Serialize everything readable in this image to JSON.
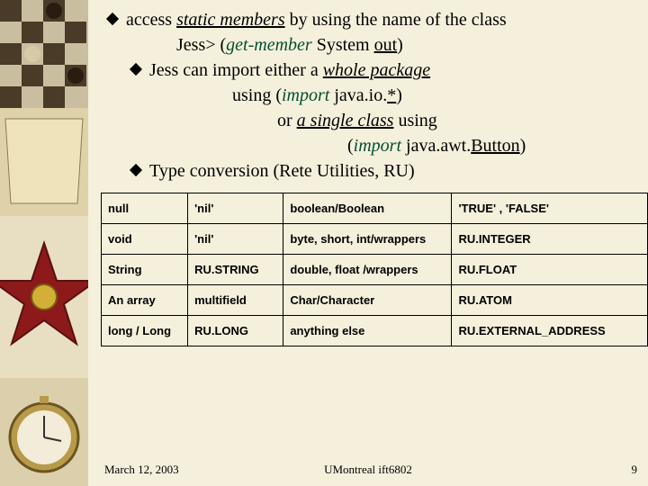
{
  "bullets": {
    "l1": "access ",
    "l1_ui": "static members",
    "l1b": " by using the name of the class",
    "l2_a": "Jess> (",
    "l2_i": "get-member",
    "l2_b": " System ",
    "l2_u": "out",
    "l2_c": ")",
    "l3": "Jess can import either a ",
    "l3_ui": "whole package",
    "l4_a": "using (",
    "l4_i": "import",
    "l4_b": " java.io.",
    "l4_u": "*",
    "l4_c": ")",
    "l5_a": "or ",
    "l5_ui": "a single class",
    "l5_b": " using",
    "l6_a": "(",
    "l6_i": "import",
    "l6_b": " java.awt.",
    "l6_u": "Button",
    "l6_c": ")",
    "l7": "Type conversion (Rete Utilities, RU)"
  },
  "table": {
    "r1c1": "null",
    "r1c2": "'nil'",
    "r1c3": "boolean/Boolean",
    "r1c4": "'TRUE' , 'FALSE'",
    "r2c1": "void",
    "r2c2": "'nil'",
    "r2c3": "byte, short, int/wrappers",
    "r2c4": "RU.INTEGER",
    "r3c1": "String",
    "r3c2": "RU.STRING",
    "r3c3": "double, float /wrappers",
    "r3c4": "RU.FLOAT",
    "r4c1": "An array",
    "r4c2": "multifield",
    "r4c3": "Char/Character",
    "r4c4": "RU.ATOM",
    "r5c1": "long / Long",
    "r5c2": "RU.LONG",
    "r5c3": "anything else",
    "r5c4": "RU.EXTERNAL_ADDRESS"
  },
  "footer": {
    "date": "March 12, 2003",
    "center": "UMontreal ift6802",
    "page": "9"
  }
}
